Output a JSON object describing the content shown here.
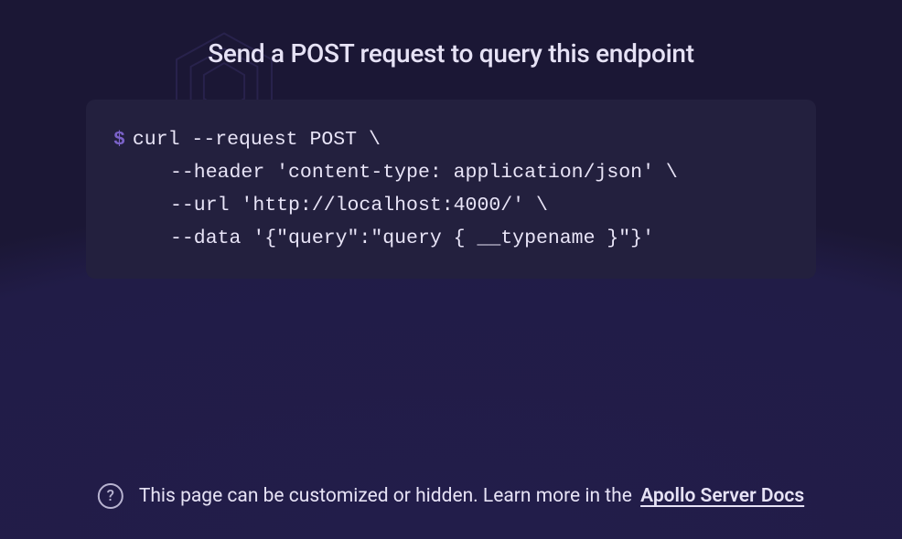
{
  "title": "Send a POST request to query this endpoint",
  "code": {
    "prompt": "$",
    "line1": "curl --request POST \\",
    "line2": "--header 'content-type: application/json' \\",
    "line3": "--url 'http://localhost:4000/' \\",
    "line4": "--data '{\"query\":\"query { __typename }\"}'"
  },
  "footer": {
    "text": "This page can be customized or hidden. Learn more in the ",
    "link_text": "Apollo Server Docs",
    "question_mark": "?"
  }
}
